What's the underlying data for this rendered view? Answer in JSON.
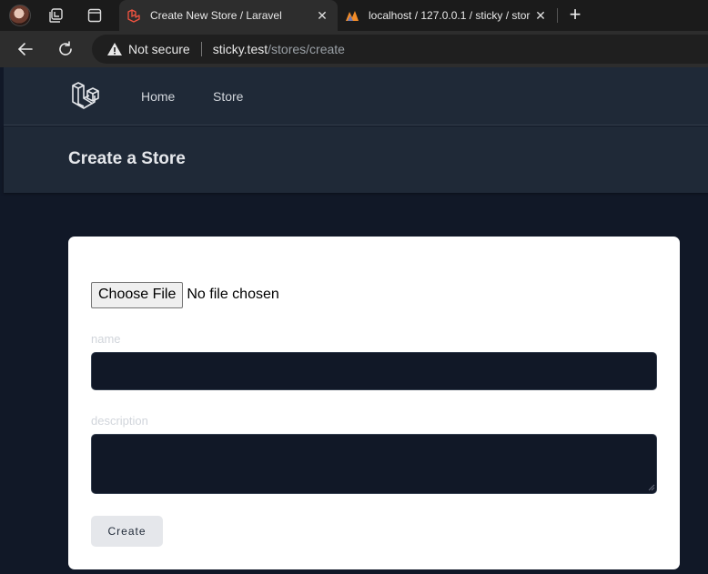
{
  "browser": {
    "active_tab": {
      "title": "Create New Store / Laravel",
      "close": "✕"
    },
    "inactive_tab": {
      "title": "localhost / 127.0.0.1 / sticky / stor",
      "close": "✕"
    },
    "new_tab": "+",
    "security_label": "Not secure",
    "url_host": "sticky.test",
    "url_path": "/stores/create"
  },
  "nav": {
    "links": [
      "Home",
      "Store"
    ]
  },
  "header": {
    "title": "Create a Store"
  },
  "form": {
    "file_button": "Choose File",
    "file_status": "No file chosen",
    "name_label": "name",
    "name_value": "",
    "description_label": "description",
    "description_value": "",
    "submit_label": "Create"
  },
  "colors": {
    "nav_bg": "#1f2937",
    "page_bg": "#111827",
    "card_bg": "#ffffff",
    "input_bg": "#111827",
    "button_bg": "#e5e7eb"
  },
  "icons": [
    "profile-avatar-icon",
    "workspaces-icon",
    "tab-actions-icon",
    "laravel-favicon",
    "phpmyadmin-favicon",
    "back-arrow-icon",
    "reload-icon",
    "warning-icon",
    "laravel-logo-icon"
  ]
}
